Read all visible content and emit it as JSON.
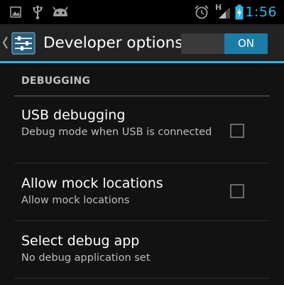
{
  "status_bar": {
    "time": "1:56",
    "accent": "#33b5e5",
    "left_icons": [
      "gallery-notification-icon",
      "usb-icon",
      "android-debug-icon"
    ],
    "right_icons": [
      "alarm-icon",
      "signal-icon",
      "battery-charging-icon"
    ],
    "network_label": "H"
  },
  "action_bar": {
    "title": "Developer options",
    "toggle_label": "ON",
    "toggle_color": "#1c7ca8",
    "divider_color": "#33b5e5"
  },
  "section": {
    "header": "DEBUGGING"
  },
  "preferences": [
    {
      "title": "USB debugging",
      "summary": "Debug mode when USB is connected",
      "checked": false
    },
    {
      "title": "Allow mock locations",
      "summary": "Allow mock locations",
      "checked": false
    },
    {
      "title": "Select debug app",
      "summary": "No debug application set"
    }
  ]
}
